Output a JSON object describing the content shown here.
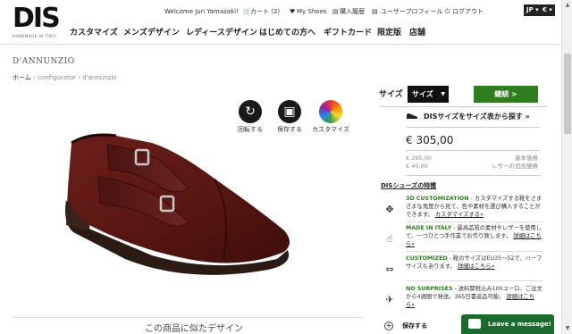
{
  "header": {
    "logo_text": "DIS",
    "logo_sub": "HANDMADE IN ITALY",
    "welcome": "Welcome Jun Yamazaki!",
    "cart": "カート (2)",
    "my_shoes": "My Shoes",
    "history": "購入履歴",
    "profile": "ユーザープロフィール",
    "logout": "ログアウト",
    "lang": "JP",
    "currency": "€",
    "nav": [
      "カスタマイズ",
      "メンズデザイン",
      "レディースデザイン",
      "はじめての方へ",
      "ギフトカード",
      "限定版",
      "店舗"
    ]
  },
  "product": {
    "title": "D'ANNUNZIO",
    "breadcrumb": [
      "ホーム",
      "configurator",
      "d'annunzio"
    ]
  },
  "tools": {
    "rotate": "回転する",
    "save": "保存する",
    "customize": "カスタマイズ"
  },
  "similar": "この商品に似たデザイン",
  "panel": {
    "size_label": "サイズ",
    "size_select": "サイズ",
    "continue": "継続 >",
    "find_size": "DISサイズをサイズ表から探す »",
    "price": "€ 305,00",
    "base_price_value": "€ 265,00",
    "base_price_label": "基本価格",
    "leather_value": "€ 40,00",
    "leather_label": "レザーの追加価格",
    "features_title": "DISシューズの特徴",
    "features": [
      {
        "icon": "3d-icon",
        "head": "3D CUSTOMIZATION",
        "text": " - カスタマイズする靴をさまざまな角度から見て、色や素材を選び購入することができます。",
        "link": "カスタマイズする»"
      },
      {
        "icon": "hand-icon",
        "head": "MADE IN ITALY",
        "text": " - 最高品質の素材やレザーを使用して、一つひとつ手作業でお作り致します。",
        "link": "詳細はこちら»"
      },
      {
        "icon": "ruler-icon",
        "head": "CUSTOMIZED",
        "text": " - 靴のサイズはEU35〜52で、ハーフサイズもあります。",
        "link": "詳細はこちら»"
      },
      {
        "icon": "plane-icon",
        "head": "NO SURPRISES",
        "text": " - 送料関税込み100ユーロ、ご注文から4週間で発送。365日書返品可能。",
        "link": "詳細はこちら»"
      }
    ],
    "bookmark": "保存する"
  },
  "chat": "Leave a message!"
}
